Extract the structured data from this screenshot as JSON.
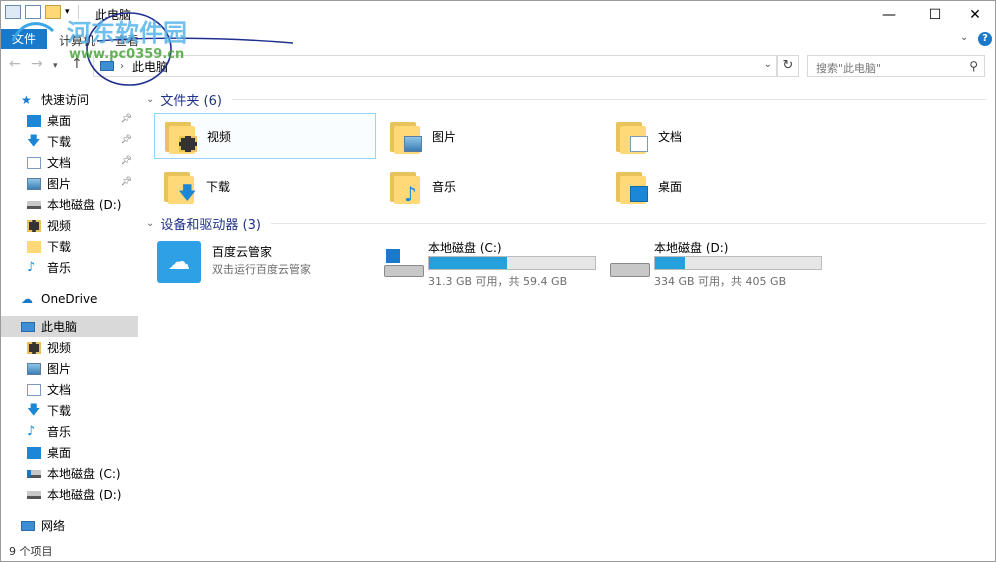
{
  "window": {
    "title": "此电脑",
    "controls": {
      "minimize": "—",
      "maximize": "☐",
      "close": "✕"
    }
  },
  "ribbon": {
    "file_tab": "文件",
    "tabs": [
      "计算机",
      "查看"
    ],
    "expand_icon": "chevron-down-icon",
    "help_icon": "?"
  },
  "nav": {
    "address_text": "此电脑",
    "search_placeholder": "搜索\"此电脑\""
  },
  "sidebar": {
    "quick_access": "快速访问",
    "quick_items": [
      {
        "label": "桌面",
        "pinned": true
      },
      {
        "label": "下载",
        "pinned": true
      },
      {
        "label": "文档",
        "pinned": true
      },
      {
        "label": "图片",
        "pinned": true
      },
      {
        "label": "本地磁盘 (D:)",
        "pinned": false
      },
      {
        "label": "视频",
        "pinned": false
      },
      {
        "label": "下载",
        "pinned": false
      },
      {
        "label": "音乐",
        "pinned": false
      }
    ],
    "onedrive": "OneDrive",
    "this_pc": "此电脑",
    "pc_items": [
      "视频",
      "图片",
      "文档",
      "下载",
      "音乐",
      "桌面",
      "本地磁盘 (C:)",
      "本地磁盘 (D:)"
    ],
    "network": "网络"
  },
  "content": {
    "folders_header": "文件夹 (6)",
    "folders": [
      "视频",
      "图片",
      "文档",
      "下载",
      "音乐",
      "桌面"
    ],
    "devices_header": "设备和驱动器 (3)",
    "app": {
      "name": "百度云管家",
      "subtitle": "双击运行百度云管家"
    },
    "drives": [
      {
        "name": "本地磁盘 (C:)",
        "free_text": "31.3 GB 可用，共 59.4 GB",
        "used_fraction": 0.47
      },
      {
        "name": "本地磁盘 (D:)",
        "free_text": "334 GB 可用，共 405 GB",
        "used_fraction": 0.18
      }
    ]
  },
  "status": {
    "item_count": "9 个项目"
  },
  "watermark": {
    "brand": "河东软件园",
    "url": "www.pc0359.cn"
  },
  "colors": {
    "accent": "#1979ca",
    "drive_fill": "#26a0da",
    "group_header": "#1e3287",
    "folder": "#ffd977"
  }
}
